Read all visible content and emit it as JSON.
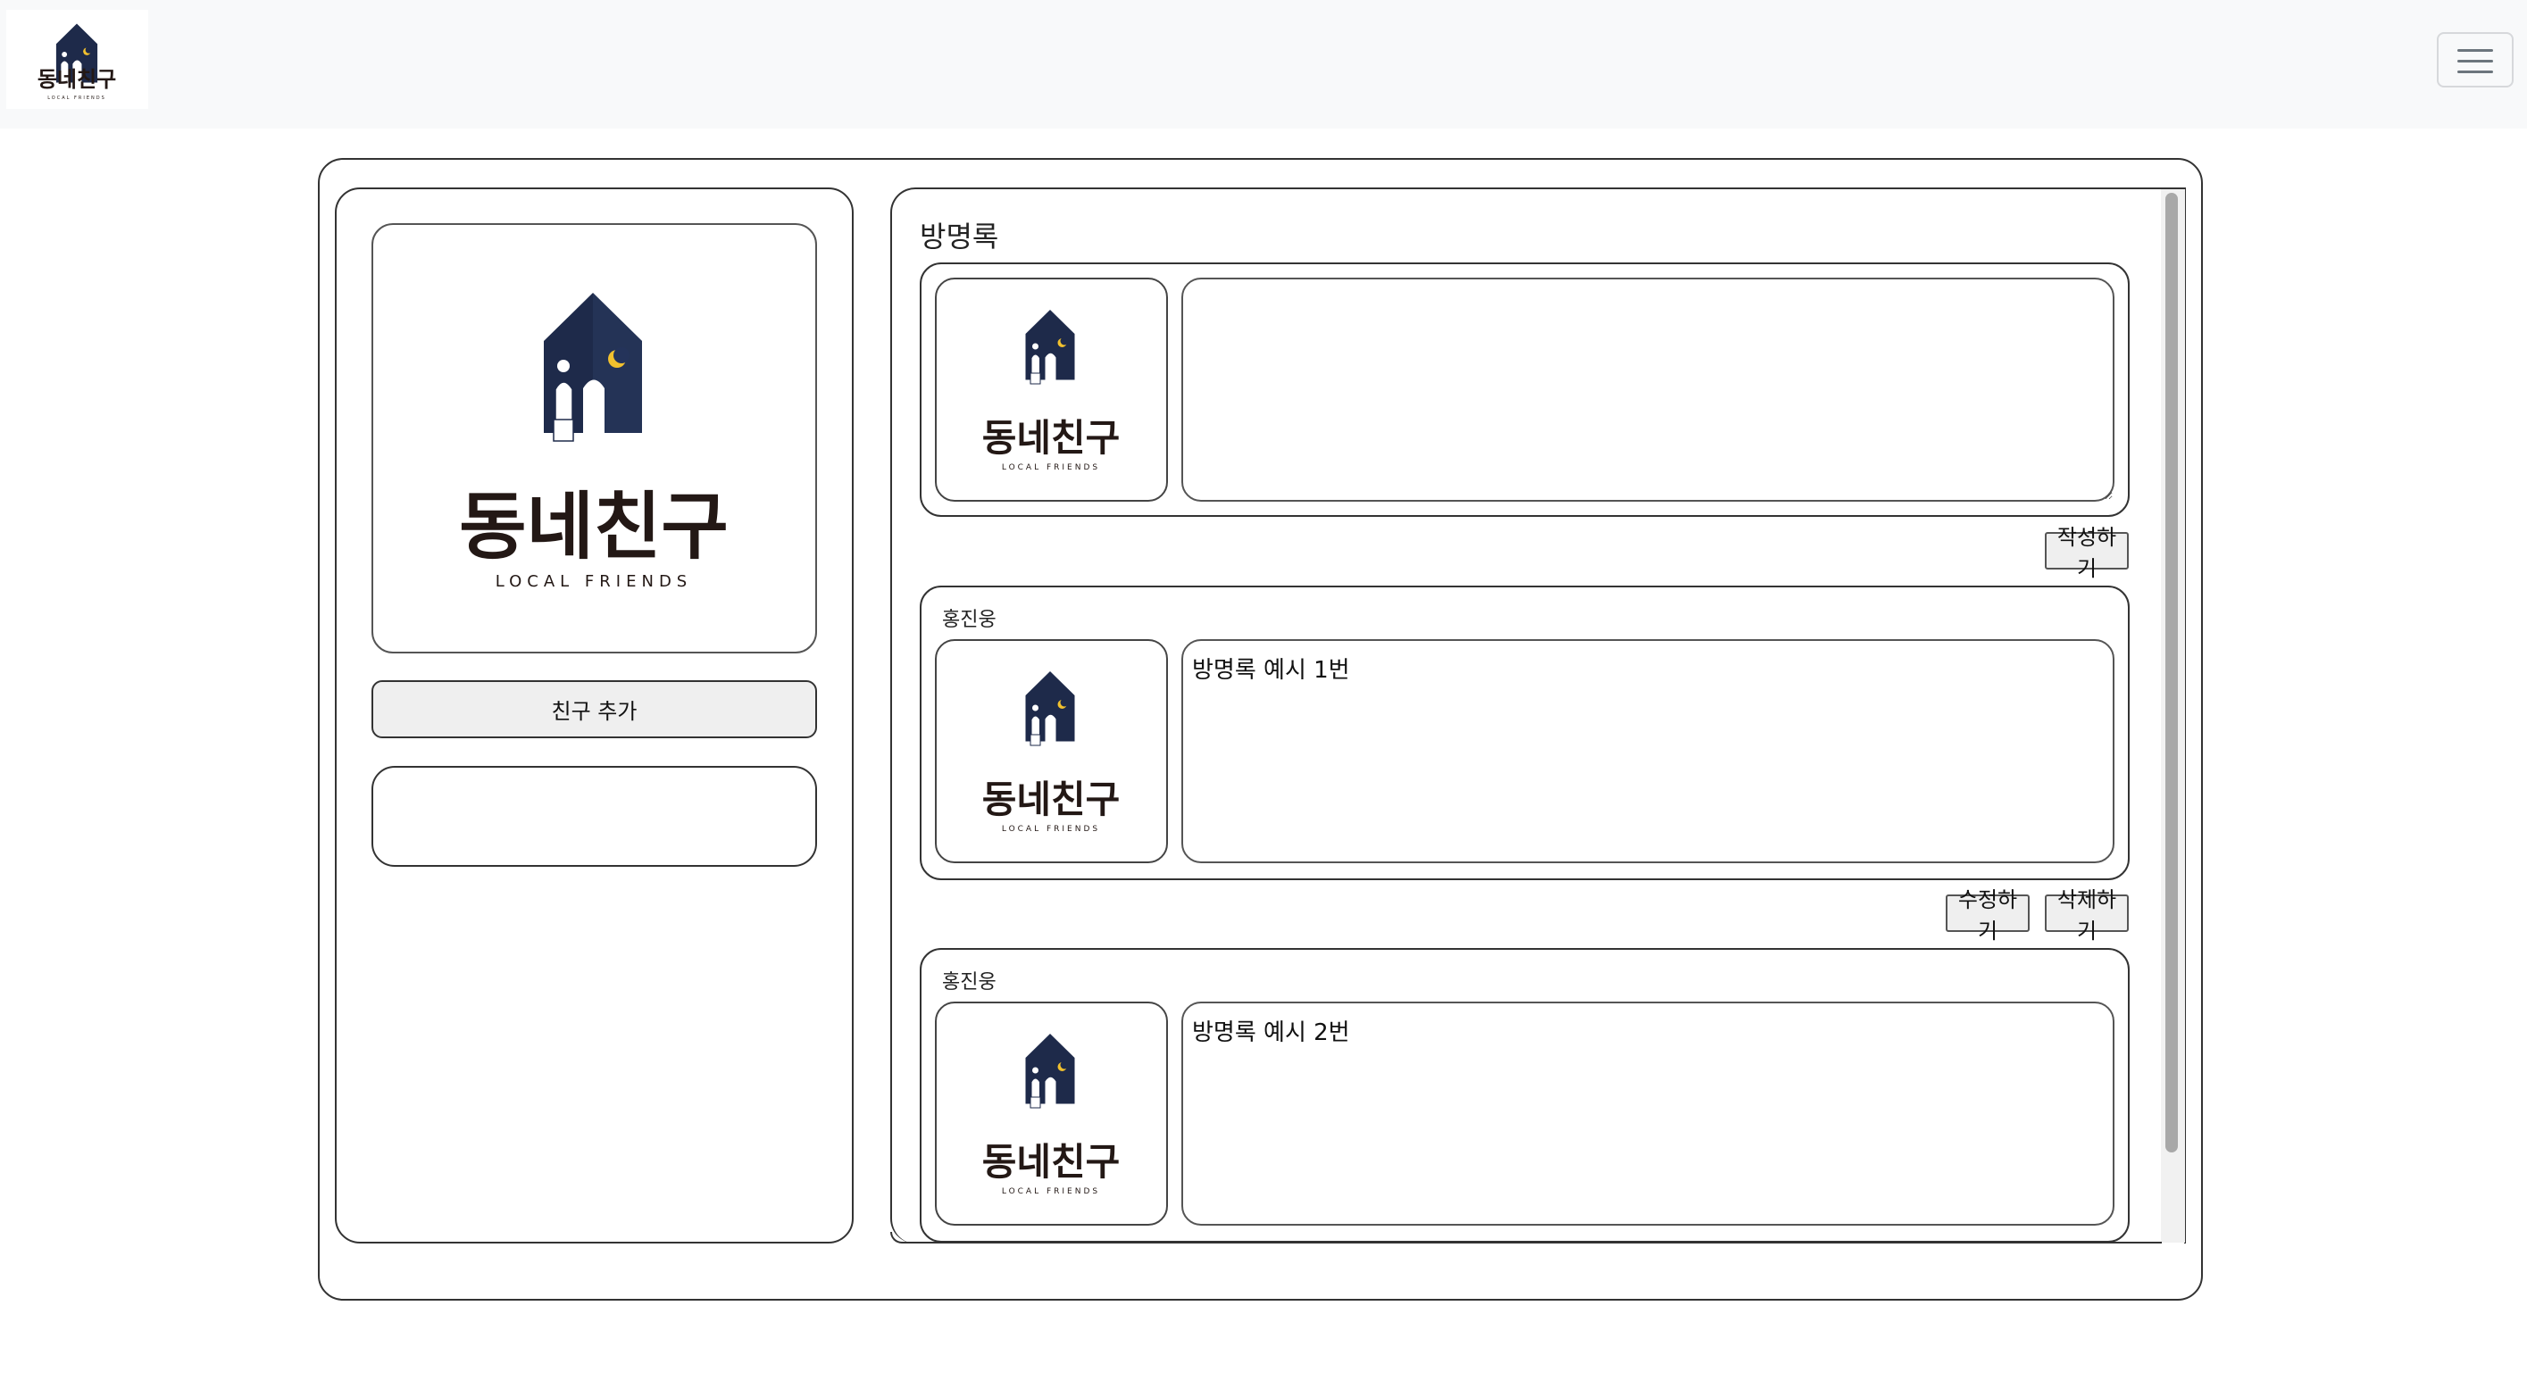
{
  "navbar": {
    "logo": {
      "brand_ko": "동네친구",
      "brand_en": "LOCAL FRIENDS"
    },
    "menu_icon": "hamburger-menu-icon"
  },
  "profile": {
    "logo": {
      "brand_ko": "동네친구",
      "brand_en": "LOCAL FRIENDS"
    },
    "add_friend_label": "친구 추가",
    "friend_box_text": ""
  },
  "guestbook": {
    "title": "방명록",
    "new_entry": {
      "placeholder": "",
      "submit_label": "작성하기"
    },
    "entries": [
      {
        "author": "홍진웅",
        "content": "방명록 예시 1번",
        "edit_label": "수정하기",
        "delete_label": "삭제하기"
      },
      {
        "author": "홍진웅",
        "content": "방명록 예시 2번"
      }
    ]
  },
  "colors": {
    "brand_navy": "#1e2a4a",
    "moon_yellow": "#f2c12e",
    "navbar_bg": "#f8f9fa",
    "text_dark": "#231815"
  }
}
